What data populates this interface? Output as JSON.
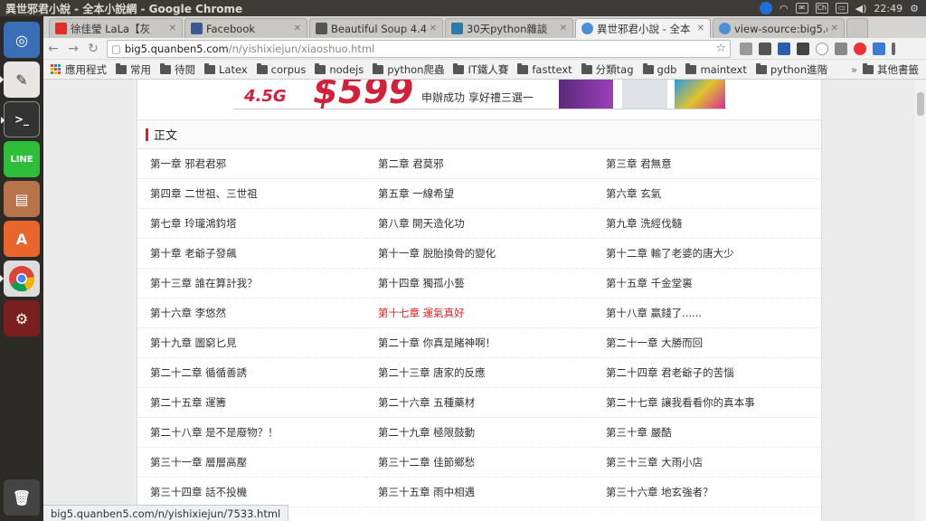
{
  "panel": {
    "window_title": "異世邪君小說 - 全本小說網 - Google Chrome",
    "keyboard": "Ch",
    "clock": "22:49"
  },
  "browser": {
    "tabs": [
      {
        "label": "徐佳瑩 LaLa【灰",
        "favicon_color": "#e52d27"
      },
      {
        "label": "Facebook",
        "favicon_color": "#3b5998"
      },
      {
        "label": "Beautiful Soup 4.4",
        "favicon_color": "#555555"
      },
      {
        "label": "30天python雜談",
        "favicon_color": "#2a7ab0"
      },
      {
        "label": "異世邪君小說 - 全本",
        "favicon_color": "#4a90d9"
      },
      {
        "label": "view-source:big5.q",
        "favicon_color": "#4a90d9"
      }
    ],
    "url_domain": "big5.quanben5.com",
    "url_path": "/n/yishixiejun/xiaoshuo.html",
    "bookmarks": [
      "應用程式",
      "常用",
      "待閱",
      "Latex",
      "corpus",
      "nodejs",
      "python爬蟲",
      "IT鐵人賽",
      "fasttext",
      "分類tag",
      "gdb",
      "maintext",
      "python進階"
    ],
    "bookmarks_more": "»",
    "other_bookmarks": "其他書籤",
    "status_url": "big5.quanben5.com/n/yishixiejun/7533.html"
  },
  "banner": {
    "tag": "4.5G",
    "price": "$599",
    "lines": "申辦成功 享好禮三選一"
  },
  "section": {
    "heading": "正文"
  },
  "chapters": [
    "第一章 邪君君邪",
    "第二章 君莫邪",
    "第三章 君無意",
    "第四章 二世祖、三世祖",
    "第五章 一線希望",
    "第六章 玄氣",
    "第七章 玲瓏鴻鈞塔",
    "第八章 開天造化功",
    "第九章 洗經伐髓",
    "第十章 老爺子發飆",
    "第十一章 脫胎換骨的變化",
    "第十二章 輸了老婆的唐大少",
    "第十三章 誰在算計我？",
    "第十四章 獨孤小藝",
    "第十五章 千金堂裏",
    "第十六章 李悠然",
    "第十七章 運氣真好",
    "第十八章 贏錢了......",
    "第十九章 圖窮匕見",
    "第二十章 你真是賭神啊！",
    "第二十一章 大勝而回",
    "第二十二章 循循善誘",
    "第二十三章 唐家的反應",
    "第二十四章 君老爺子的苦惱",
    "第二十五章 運籌",
    "第二十六章 五種藥材",
    "第二十七章 讓我看看你的真本事",
    "第二十八章 是不是廢物？！",
    "第二十九章 極限鼓動",
    "第三十章 嚴酷",
    "第三十一章 層層高壓",
    "第三十二章 佳節鄉愁",
    "第三十三章 大雨小店",
    "第三十四章 話不投機",
    "第三十五章 雨中相遇",
    "第三十六章 地玄強者？"
  ],
  "highlighted_chapter_index": 16
}
